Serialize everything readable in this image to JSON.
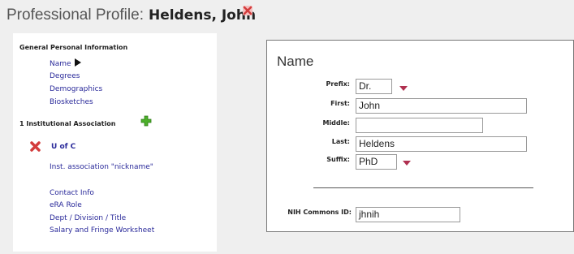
{
  "header": {
    "label": "Professional Profile:",
    "name": "Heldens, John"
  },
  "sidebar": {
    "general_heading": "General Personal Information",
    "general_items": [
      {
        "label": "Name"
      },
      {
        "label": "Degrees"
      },
      {
        "label": "Demographics"
      },
      {
        "label": "Biosketches"
      }
    ],
    "institution_heading": "1 Institutional Association",
    "institution_name": "U of C",
    "institution_items": [
      {
        "label": "Inst. association \"nickname\""
      },
      {
        "label": "Contact Info"
      },
      {
        "label": "eRA Role"
      },
      {
        "label": "Dept / Division / Title"
      },
      {
        "label": "Salary and Fringe Worksheet"
      }
    ]
  },
  "panel": {
    "title": "Name",
    "prefix": {
      "label": "Prefix:",
      "value": "Dr."
    },
    "first": {
      "label": "First:",
      "value": "John"
    },
    "middle": {
      "label": "Middle:",
      "value": ""
    },
    "last": {
      "label": "Last:",
      "value": "Heldens"
    },
    "suffix": {
      "label": "Suffix:",
      "value": "PhD"
    },
    "nih_id": {
      "label": "NIH Commons ID:",
      "value": "jhnih"
    }
  },
  "colors": {
    "link": "#2a2a9a",
    "delete_icon": "#d33c3c",
    "add_icon": "#4caf2a",
    "dropdown_caret": "#b03050"
  }
}
